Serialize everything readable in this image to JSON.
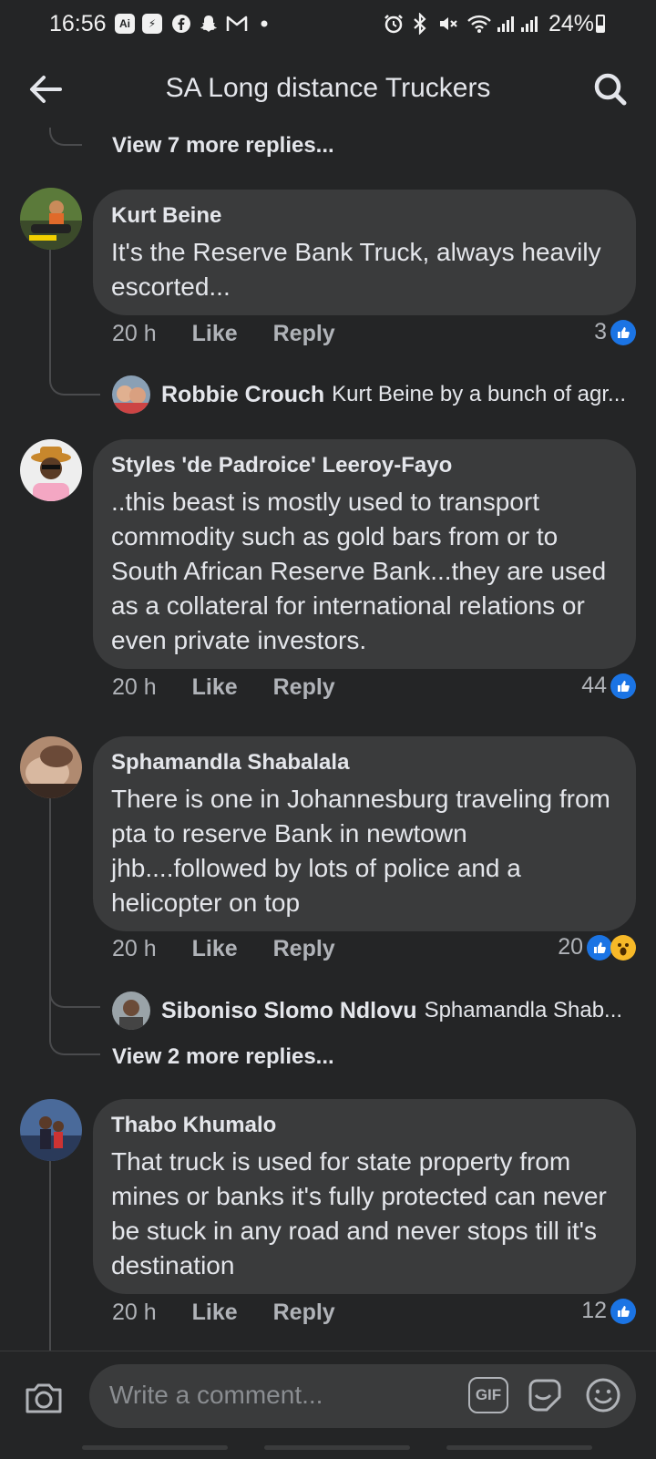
{
  "status_bar": {
    "time": "16:56",
    "battery": "24%",
    "left_icons": [
      "ai-icon",
      "messenger-icon",
      "facebook-icon",
      "snapchat-icon",
      "gmail-icon",
      "dot-icon"
    ],
    "right_icons": [
      "alarm-icon",
      "bluetooth-icon",
      "mute-icon",
      "wifi-icon",
      "signal-icon",
      "signal-icon",
      "battery-icon"
    ]
  },
  "header": {
    "title": "SA Long distance Truckers"
  },
  "thread": {
    "top_view_more": "View 7 more replies...",
    "comments": [
      {
        "author": "Kurt Beine",
        "text": "It's the Reserve Bank Truck, always heavily escorted...",
        "time": "20 h",
        "like": "Like",
        "reply": "Reply",
        "reactions": "3",
        "reply_preview": {
          "author": "Robbie Crouch",
          "text": "Kurt Beine by a bunch of agr..."
        }
      },
      {
        "author": "Styles 'de Padroice' Leeroy-Fayo",
        "text": "..this beast is mostly used to transport commodity such as gold bars  from or to South African Reserve Bank...they are used as a collateral for international relations or even private investors.",
        "time": "20 h",
        "like": "Like",
        "reply": "Reply",
        "reactions": "44"
      },
      {
        "author": "Sphamandla Shabalala",
        "text": "There is one in Johannesburg  traveling from pta to reserve Bank in newtown jhb....followed by lots of police and a helicopter on top",
        "time": "20 h",
        "like": "Like",
        "reply": "Reply",
        "reactions": "20",
        "reply_preview": {
          "author": "Siboniso Slomo Ndlovu",
          "text": "Sphamandla Shab..."
        },
        "view_more": "View 2 more replies..."
      },
      {
        "author": "Thabo Khumalo",
        "text": "That truck is used for state property from mines or banks it's fully protected can never  be stuck in any road and never stops till it's destination",
        "time": "20 h",
        "like": "Like",
        "reply": "Reply",
        "reactions": "12"
      }
    ]
  },
  "composer": {
    "placeholder": "Write a comment...",
    "gif_label": "GIF"
  },
  "colors": {
    "background": "#242526",
    "bubble": "#3a3b3c",
    "like_blue": "#1b74e4",
    "text": "#e4e6eb",
    "muted": "#b0b3b8"
  }
}
